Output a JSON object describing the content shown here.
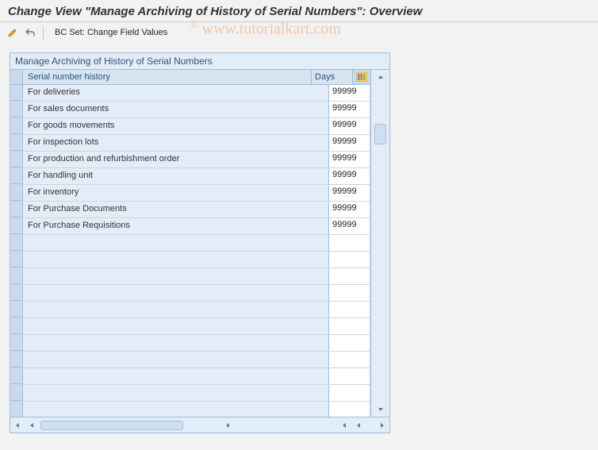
{
  "title": "Change View \"Manage Archiving of History of Serial Numbers\": Overview",
  "toolbar": {
    "action_label": "BC Set: Change Field Values"
  },
  "watermark": "www.tutorialkart.com",
  "panel": {
    "title": "Manage Archiving of History of Serial Numbers",
    "columns": {
      "col1": "Serial number history",
      "col2": "Days"
    },
    "rows": [
      {
        "label": "For deliveries",
        "days": "99999"
      },
      {
        "label": "For sales documents",
        "days": "99999"
      },
      {
        "label": "For goods movements",
        "days": "99999"
      },
      {
        "label": "For inspection lots",
        "days": "99999"
      },
      {
        "label": "For production and refurbishment order",
        "days": "99999"
      },
      {
        "label": "For handling unit",
        "days": "99999"
      },
      {
        "label": "For inventory",
        "days": "99999"
      },
      {
        "label": "For Purchase Documents",
        "days": "99999"
      },
      {
        "label": "For Purchase Requisitions",
        "days": "99999"
      },
      {
        "label": "",
        "days": ""
      },
      {
        "label": "",
        "days": ""
      },
      {
        "label": "",
        "days": ""
      },
      {
        "label": "",
        "days": ""
      },
      {
        "label": "",
        "days": ""
      },
      {
        "label": "",
        "days": ""
      },
      {
        "label": "",
        "days": ""
      },
      {
        "label": "",
        "days": ""
      },
      {
        "label": "",
        "days": ""
      },
      {
        "label": "",
        "days": ""
      },
      {
        "label": "",
        "days": ""
      }
    ]
  }
}
